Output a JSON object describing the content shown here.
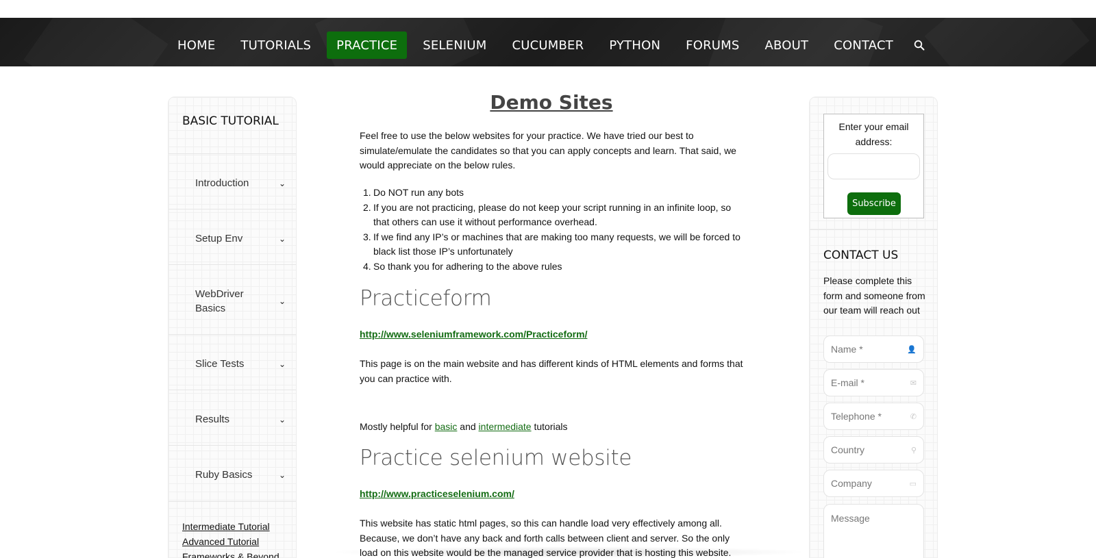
{
  "nav": {
    "items": [
      {
        "label": "HOME",
        "active": false
      },
      {
        "label": "TUTORIALS",
        "active": false
      },
      {
        "label": "PRACTICE",
        "active": true
      },
      {
        "label": "SELENIUM",
        "active": false
      },
      {
        "label": "CUCUMBER",
        "active": false
      },
      {
        "label": "PYTHON",
        "active": false
      },
      {
        "label": "FORUMS",
        "active": false
      },
      {
        "label": "ABOUT",
        "active": false
      },
      {
        "label": "CONTACT",
        "active": false
      }
    ],
    "search_icon": "search-icon",
    "active_color": "#0d6e0d"
  },
  "sidebar": {
    "title": "BASIC TUTORIAL",
    "items": [
      {
        "label": "Introduction",
        "chevron": "⌄"
      },
      {
        "label": "Setup Env",
        "chevron": "⌄"
      },
      {
        "label": "WebDriver Basics",
        "chevron": "⌄"
      },
      {
        "label": "Slice Tests",
        "chevron": "⌄"
      },
      {
        "label": "Results",
        "chevron": "⌄"
      },
      {
        "label": "Ruby Basics",
        "chevron": "⌄"
      }
    ],
    "links": [
      "Intermediate Tutorial",
      "Advanced Tutorial",
      "Frameworks & Beyond"
    ]
  },
  "main": {
    "title": "Demo Sites",
    "intro": "Feel free to use the below websites for your practice. We have tried our best to simulate/emulate the candidates so that you can apply concepts and learn. That said, we would appreciate on the below rules.",
    "rules": [
      "Do NOT run any bots",
      "If you are not practicing, please do not keep your script running in an infinite loop, so that others can use it without performance overhead.",
      "If we find any IP’s or machines that are making too many requests, we will be forced to black list those IP’s unfortunately",
      "So thank you for adhering to the above rules"
    ],
    "section1": {
      "heading": "Practiceform",
      "link": "http://www.seleniumframework.com/Practiceform/",
      "desc": "This page is on the main website and has different kinds of HTML elements and forms that you can practice with.",
      "helpful_prefix": "Mostly helpful for ",
      "helpful_link1": "basic",
      "helpful_mid": " and ",
      "helpful_link2": "intermediate",
      "helpful_suffix": " tutorials"
    },
    "section2": {
      "heading": "Practice selenium website",
      "link": "http://www.practiceselenium.com/",
      "desc": "This website has static html pages, so this can handle load very effectively among all. Because, we don’t have any back and forth calls between client and server. So the only load on this website would be the managed service provider that is hosting this website."
    }
  },
  "subscribe": {
    "label": "Enter your email address:",
    "button": "Subscribe"
  },
  "contact": {
    "title": "CONTACT US",
    "desc": "Please complete this form and someone from our team will reach out",
    "fields": [
      {
        "placeholder": "Name *",
        "icon": "user-icon",
        "glyph": "👤"
      },
      {
        "placeholder": "E-mail *",
        "icon": "envelope-icon",
        "glyph": "✉"
      },
      {
        "placeholder": "Telephone *",
        "icon": "phone-icon",
        "glyph": "✆"
      },
      {
        "placeholder": "Country",
        "icon": "map-pin-icon",
        "glyph": "⚲"
      },
      {
        "placeholder": "Company",
        "icon": "briefcase-icon",
        "glyph": "▭"
      }
    ],
    "message_placeholder": "Message"
  }
}
